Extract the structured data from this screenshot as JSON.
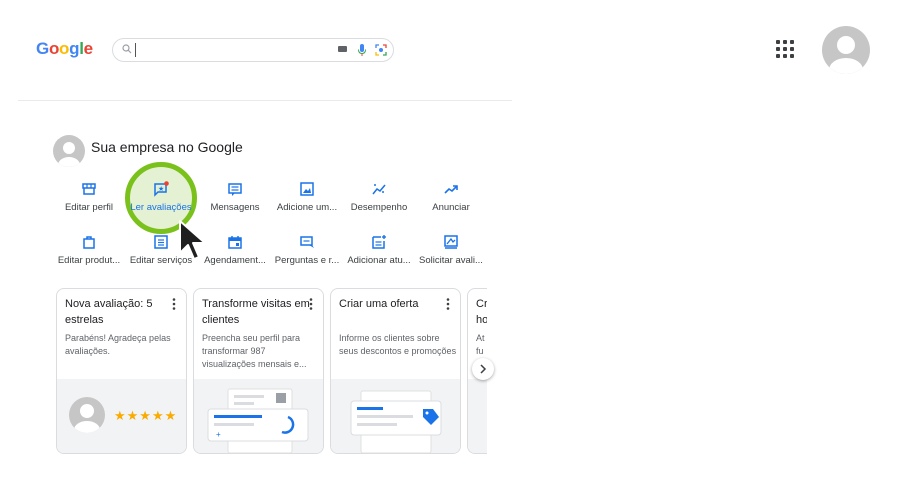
{
  "header": {
    "logo_letters": [
      {
        "ch": "G",
        "color": "#4285f4"
      },
      {
        "ch": "o",
        "color": "#ea4335"
      },
      {
        "ch": "o",
        "color": "#fbbc05"
      },
      {
        "ch": "g",
        "color": "#4285f4"
      },
      {
        "ch": "l",
        "color": "#34a853"
      },
      {
        "ch": "e",
        "color": "#ea4335"
      }
    ],
    "search_value": "",
    "icons": [
      "search-icon",
      "keyboard-icon",
      "mic-icon",
      "lens-icon",
      "apps-grid-icon",
      "account-avatar"
    ]
  },
  "business": {
    "title": "Sua empresa no Google"
  },
  "actions": [
    {
      "label": "Editar perfil",
      "icon": "storefront-icon"
    },
    {
      "label": "Ler avaliações",
      "icon": "reviews-icon",
      "highlighted": true
    },
    {
      "label": "Mensagens",
      "icon": "messages-icon"
    },
    {
      "label": "Adicione um...",
      "icon": "add-photo-icon"
    },
    {
      "label": "Desempenho",
      "icon": "performance-icon"
    },
    {
      "label": "Anunciar",
      "icon": "trending-up-icon"
    },
    {
      "label": "Editar produt...",
      "icon": "shopping-bag-icon"
    },
    {
      "label": "Editar serviços",
      "icon": "services-list-icon"
    },
    {
      "label": "Agendament...",
      "icon": "calendar-icon"
    },
    {
      "label": "Perguntas e r...",
      "icon": "qa-icon"
    },
    {
      "label": "Adicionar atu...",
      "icon": "add-update-icon"
    },
    {
      "label": "Solicitar avali...",
      "icon": "request-review-icon"
    }
  ],
  "cards": [
    {
      "title": "Nova avaliação: 5 estrelas",
      "desc": "Parabéns! Agradeça pelas avaliações.",
      "stars": "★★★★★"
    },
    {
      "title": "Transforme visitas em clientes",
      "desc": "Preencha seu perfil para transformar 987 visualizações mensais e..."
    },
    {
      "title": "Criar uma oferta",
      "desc": "Informe os clientes sobre seus descontos e promoções"
    },
    {
      "title": "Cr ho",
      "desc": "At fu"
    }
  ],
  "colors": {
    "accent": "#1a73e8",
    "highlight_ring": "#7ac11b",
    "notification_dot": "#ea4335",
    "stars": "#f9ab00"
  }
}
